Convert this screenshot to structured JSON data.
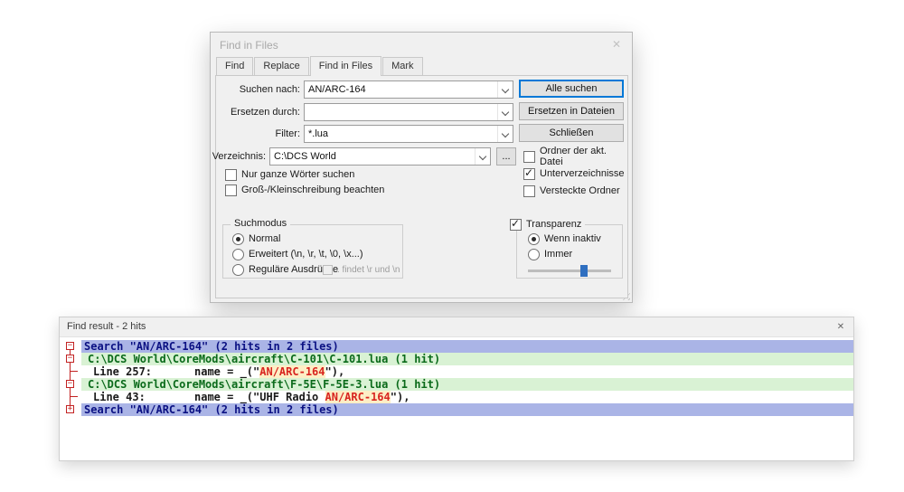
{
  "icons": {
    "close": "✕",
    "check": "✓"
  },
  "colors": {
    "default_button_border": "#0078d7",
    "match_text": "#d8241f",
    "search_line_bg": "#aab4e6",
    "file_line_bg": "#d9f2d4",
    "fold_tree": "#c22222",
    "slider_thumb": "#2f6fc0"
  },
  "dialog": {
    "title": "Find in Files",
    "tabs": [
      "Find",
      "Replace",
      "Find in Files",
      "Mark"
    ],
    "active_tab": "Find in Files",
    "fields": {
      "search_label": "Suchen nach:",
      "search_value": "AN/ARC-164",
      "replace_label": "Ersetzen durch:",
      "replace_value": "",
      "filter_label": "Filter:",
      "filter_value": "*.lua",
      "dir_label": "Verzeichnis:",
      "dir_value": "C:\\DCS World",
      "browse_label": "..."
    },
    "buttons": {
      "find_all": "Alle suchen",
      "replace_in_files": "Ersetzen in Dateien",
      "close": "Schließen"
    },
    "checkboxes": {
      "follow_doc": {
        "label": "Ordner der akt. Datei",
        "checked": false
      },
      "subdirs": {
        "label": "Unterverzeichnisse",
        "checked": true
      },
      "hidden": {
        "label": "Versteckte Ordner",
        "checked": false
      },
      "whole_word": {
        "label": "Nur ganze Wörter suchen",
        "checked": false
      },
      "match_case": {
        "label": "Groß-/Kleinschreibung beachten",
        "checked": false
      }
    },
    "search_mode": {
      "title": "Suchmodus",
      "normal": "Normal",
      "extended": "Erweitert (\\n, \\r, \\t, \\0, \\x...)",
      "regex": "Reguläre Ausdrücke",
      "selected": "Normal",
      "dot_matches": ". findet \\r und \\n"
    },
    "transparency": {
      "label": "Transparenz",
      "checked": true,
      "on_inactive": "Wenn inaktiv",
      "always": "Immer",
      "selected": "Wenn inaktiv"
    }
  },
  "results": {
    "title": "Find result - 2 hits",
    "lines": [
      {
        "type": "search",
        "fold": "−",
        "text": "Search \"AN/ARC-164\" (2 hits in 2 files)"
      },
      {
        "type": "file",
        "fold": "−",
        "text": "C:\\DCS World\\CoreMods\\aircraft\\C-101\\C-101.lua (1 hit)"
      },
      {
        "type": "hit",
        "pre": "Line 257:",
        "before": "name = _(\"",
        "match": "AN/ARC-164",
        "after": "\"),"
      },
      {
        "type": "file",
        "fold": "−",
        "text": "C:\\DCS World\\CoreMods\\aircraft\\F-5E\\F-5E-3.lua (1 hit)"
      },
      {
        "type": "hit",
        "pre": "Line 43:",
        "before": "name = _(\"UHF Radio ",
        "match": "AN/ARC-164",
        "after": "\"),"
      },
      {
        "type": "search",
        "fold": "+",
        "text": "Search \"AN/ARC-164\" (2 hits in 2 files)"
      }
    ]
  }
}
